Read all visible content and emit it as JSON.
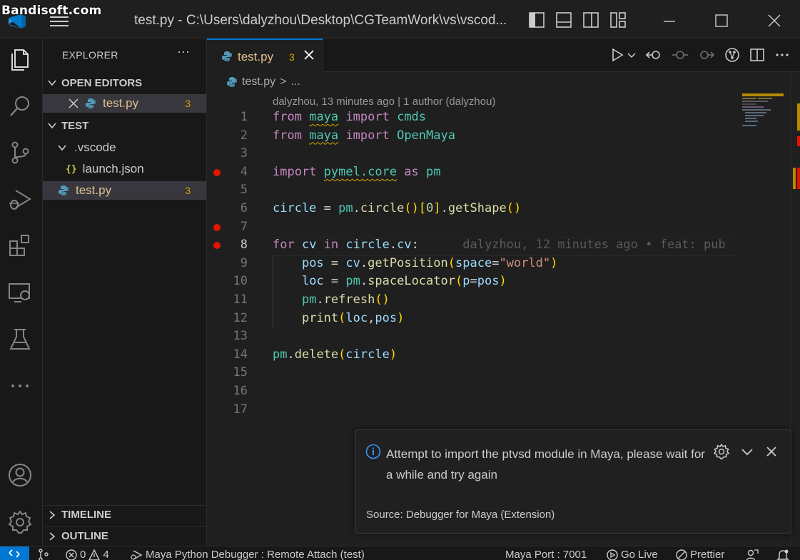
{
  "watermark": "Bandisoft.com",
  "titlebar": {
    "title": "test.py - C:\\Users\\dalyzhou\\Desktop\\CGTeamWork\\vs\\vscod..."
  },
  "sidebar": {
    "header": "EXPLORER",
    "more": "···",
    "open_editors_label": "OPEN EDITORS",
    "open_editor_file": "test.py",
    "open_editor_badge": "3",
    "folder_label": "TEST",
    "vscode_folder": ".vscode",
    "launch_json": "launch.json",
    "launch_icon": "{}",
    "file": "test.py",
    "file_badge": "3",
    "timeline_label": "TIMELINE",
    "outline_label": "OUTLINE"
  },
  "tab": {
    "label": "test.py",
    "badge": "3"
  },
  "breadcrumb": {
    "file": "test.py",
    "sep": ">",
    "more": "..."
  },
  "blame_header": "dalyzhou, 13 minutes ago | 1 author (dalyzhou)",
  "code": {
    "line_numbers": [
      "1",
      "2",
      "3",
      "4",
      "5",
      "6",
      "7",
      "8",
      "9",
      "10",
      "11",
      "12",
      "13",
      "14",
      "15",
      "16",
      "17"
    ],
    "inline_blame": "dalyzhou, 12 minutes ago • feat: pub"
  },
  "notification": {
    "message": "Attempt to import the ptvsd module in Maya, please wait for a while and try again",
    "source": "Source: Debugger for Maya (Extension)"
  },
  "statusbar": {
    "errors": "0",
    "warnings": "4",
    "debug_config": "Maya Python Debugger : Remote Attach (test)",
    "maya_port": "Maya Port : 7001",
    "go_live": "Go Live",
    "prettier": "Prettier"
  },
  "colors": {
    "accent": "#0078d4",
    "breakpoint": "#e51400",
    "warning": "#cca700",
    "modified_file": "#e2c08d"
  }
}
